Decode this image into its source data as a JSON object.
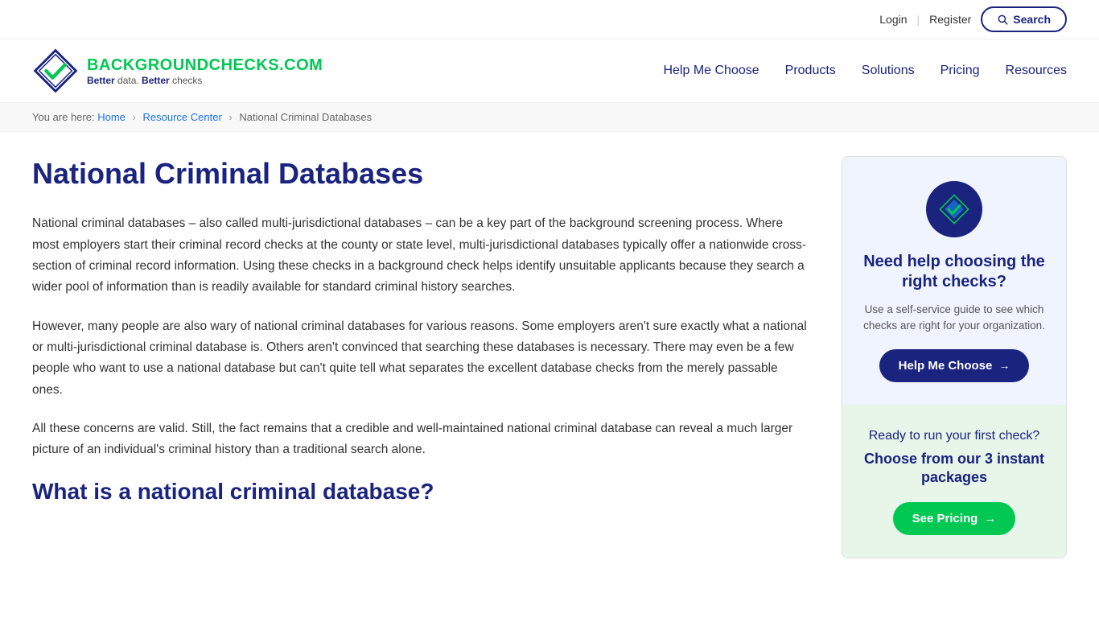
{
  "topbar": {
    "login_label": "Login",
    "divider": "|",
    "register_label": "Register",
    "search_label": "Search"
  },
  "header": {
    "logo_name_part1": "BACKGROUND",
    "logo_name_part2": "CHECKS.COM",
    "tagline_part1": "Better",
    "tagline_text1": " data. ",
    "tagline_part2": "Better",
    "tagline_text2": " checks",
    "nav": {
      "item1": "Help Me Choose",
      "item2": "Products",
      "item3": "Solutions",
      "item4": "Pricing",
      "item5": "Resources"
    }
  },
  "breadcrumb": {
    "prefix": "You are here:",
    "home": "Home",
    "sep1": "›",
    "resource_center": "Resource Center",
    "sep2": "›",
    "current": "National Criminal Databases"
  },
  "main": {
    "page_title": "National Criminal Databases",
    "para1": "National criminal databases – also called multi-jurisdictional databases – can be a key part of the background screening process. Where most employers start their criminal record checks at the county or state level, multi-jurisdictional databases typically offer a nationwide cross-section of criminal record information. Using these checks in a background check helps identify unsuitable applicants because they search a wider pool of information than is readily available for standard criminal history searches.",
    "para2": "However, many people are also wary of national criminal databases for various reasons. Some employers aren't sure exactly what a national or multi-jurisdictional criminal database is. Others aren't convinced that searching these databases is necessary. There may even be a few people who want to use a national database but can't quite tell what separates the excellent database checks from the merely passable ones.",
    "para3": "All these concerns are valid. Still, the fact remains that a credible and well-maintained national criminal database can reveal a much larger picture of an individual's criminal history than a traditional search alone.",
    "subheading": "What is a national criminal database?"
  },
  "sidebar": {
    "card1": {
      "heading": "Need help choosing the right checks?",
      "description": "Use a self-service guide to see which checks are right for your organization.",
      "button_label": "Help Me Choose"
    },
    "card2": {
      "intro": "Ready to run your first check?",
      "heading": "Choose from our 3 instant packages",
      "button_label": "See Pricing"
    }
  }
}
